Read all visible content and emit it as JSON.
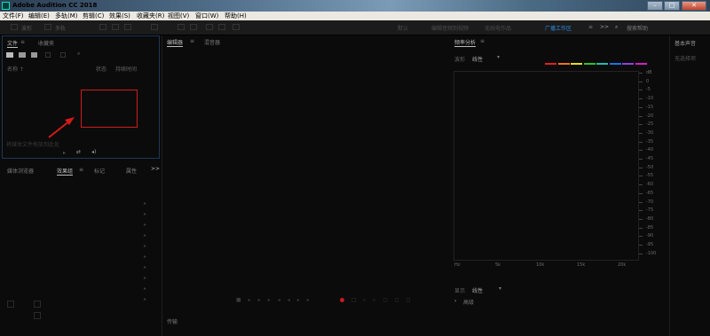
{
  "window": {
    "title": "Adobe Audition CC 2018",
    "min": "–",
    "max": "□",
    "close": "✕"
  },
  "menu": [
    "文件(F)",
    "编辑(E)",
    "多轨(M)",
    "剪辑(C)",
    "效果(S)",
    "收藏夹(R)",
    "视图(V)",
    "窗口(W)",
    "帮助(H)"
  ],
  "toolbar": {
    "waveform": "波形",
    "multitrack": "多轨",
    "workspaces": [
      "默认",
      "编辑音频到视频",
      "无线电作品",
      "广播工作区"
    ],
    "active_workspace": "广播工作区",
    "more": ">>",
    "search_placeholder": "搜索帮助"
  },
  "files_panel": {
    "tabs": [
      "文件",
      "收藏夹"
    ],
    "columns": {
      "name": "名称 ↑",
      "status": "状态",
      "duration": "持续时间"
    },
    "hint": "将媒体文件拖放到此处"
  },
  "left_bottom": {
    "tabs": [
      "媒体浏览器",
      "效果组",
      "标记",
      "属性"
    ],
    "active": "效果组",
    "more": ">>"
  },
  "editor": {
    "tabs": [
      "编辑器",
      "混音器"
    ],
    "active": "编辑器"
  },
  "transport_label": "传输",
  "frequency": {
    "title": "频率分析",
    "waveform_label": "波形",
    "waveform_value": "线性",
    "channel_colors": [
      "#e02020",
      "#f07020",
      "#e0e020",
      "#30c030",
      "#20c0a0",
      "#2070e0",
      "#9040e0",
      "#d020c0"
    ],
    "db_scale": [
      "dB",
      "0",
      "-5",
      "-10",
      "-15",
      "-20",
      "-25",
      "-30",
      "-35",
      "-40",
      "-45",
      "-50",
      "-55",
      "-60",
      "-65",
      "-70",
      "-75",
      "-80",
      "-85",
      "-90",
      "-95",
      "-100"
    ],
    "freq_labels": [
      "Hz",
      "5k",
      "10k",
      "15k",
      "20k"
    ],
    "display_label": "显示",
    "display_value": "线性",
    "advanced": "高级"
  },
  "right_panel": {
    "title": "基本声音",
    "sub": "无选择项"
  }
}
